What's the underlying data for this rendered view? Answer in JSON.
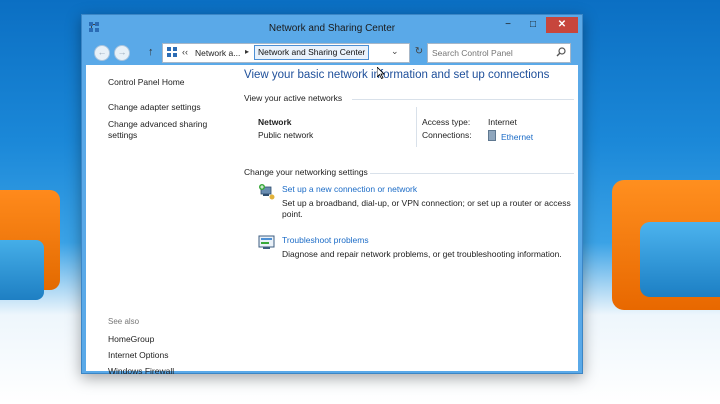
{
  "window": {
    "title": "Network and Sharing Center",
    "controls": {
      "minimize": "−",
      "maximize": "□",
      "close": "✕"
    }
  },
  "navbar": {
    "back_icon": "←",
    "forward_icon": "→",
    "up_icon": "↑",
    "address": {
      "double_chevron": "‹‹",
      "crumb1": "Network a...",
      "separator": "▸",
      "current": "Network and Sharing Center",
      "dropdown": "⌄"
    },
    "refresh_icon": "↻",
    "search_placeholder": "Search Control Panel"
  },
  "sidebar": {
    "home": "Control Panel Home",
    "adapter": "Change adapter settings",
    "advanced": "Change advanced sharing settings",
    "see_also": "See also",
    "homegroup": "HomeGroup",
    "internet_options": "Internet Options",
    "firewall": "Windows Firewall"
  },
  "main": {
    "heading": "View your basic network information and set up connections",
    "active_label": "View your active networks",
    "network": {
      "name": "Network",
      "category": "Public network",
      "access_key": "Access type:",
      "access_value": "Internet",
      "connections_key": "Connections:",
      "connections_value": "Ethernet"
    },
    "settings_label": "Change your networking settings",
    "tasks": [
      {
        "title": "Set up a new connection or network",
        "desc": "Set up a broadband, dial-up, or VPN connection; or set up a router or access point."
      },
      {
        "title": "Troubleshoot problems",
        "desc": "Diagnose and repair network problems, or get troubleshooting information."
      }
    ]
  },
  "colors": {
    "accent_link": "#1c6cc7",
    "heading": "#1e4f9a",
    "window_frame": "#5aa9e8",
    "close_button": "#c7463c"
  }
}
